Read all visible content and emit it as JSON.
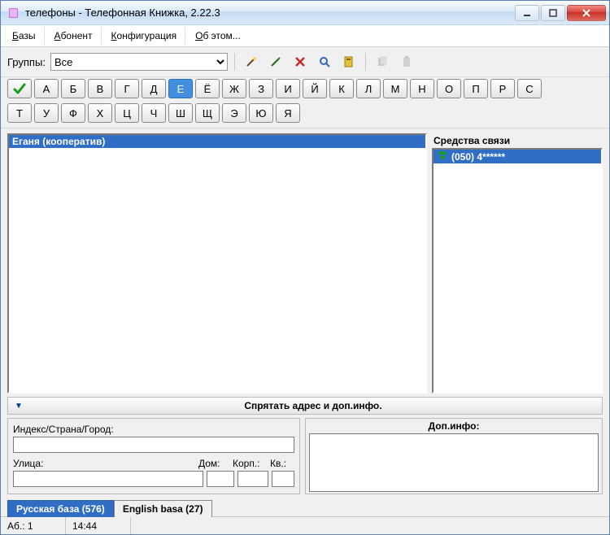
{
  "window": {
    "title": "телефоны - Телефонная Книжка, 2.22.3"
  },
  "menu": {
    "bases": "Базы",
    "abonent": "Абонент",
    "config": "Конфигурация",
    "about": "Об этом..."
  },
  "toolbar": {
    "groups_label": "Группы:",
    "groups_value": "Все"
  },
  "alpha": {
    "row1": [
      "А",
      "Б",
      "В",
      "Г",
      "Д",
      "Е",
      "Ё",
      "Ж",
      "З",
      "И",
      "Й",
      "К",
      "Л",
      "М",
      "Н",
      "О",
      "П",
      "Р",
      "С"
    ],
    "row2": [
      "Т",
      "У",
      "Ф",
      "Х",
      "Ц",
      "Ч",
      "Ш",
      "Щ",
      "Э",
      "Ю",
      "Я"
    ],
    "active": "Е"
  },
  "contacts": {
    "selected": "Еганя (кооператив)"
  },
  "comm": {
    "header": "Средства связи",
    "phone": "(050) 4******"
  },
  "collapse": {
    "label": "Спрятать адрес и доп.инфо."
  },
  "addr": {
    "index_label": "Индекс/Страна/Город:",
    "street_label": "Улица:",
    "house_label": "Дом:",
    "korp_label": "Корп.:",
    "kv_label": "Кв.:",
    "index_value": "",
    "street_value": "",
    "house_value": "",
    "korp_value": "",
    "kv_value": ""
  },
  "extra": {
    "header": "Доп.инфо:"
  },
  "tabs": {
    "ru": "Русская база (576)",
    "en": "English basa (27)"
  },
  "status": {
    "ab": "Аб.: 1",
    "time": "14:44"
  }
}
